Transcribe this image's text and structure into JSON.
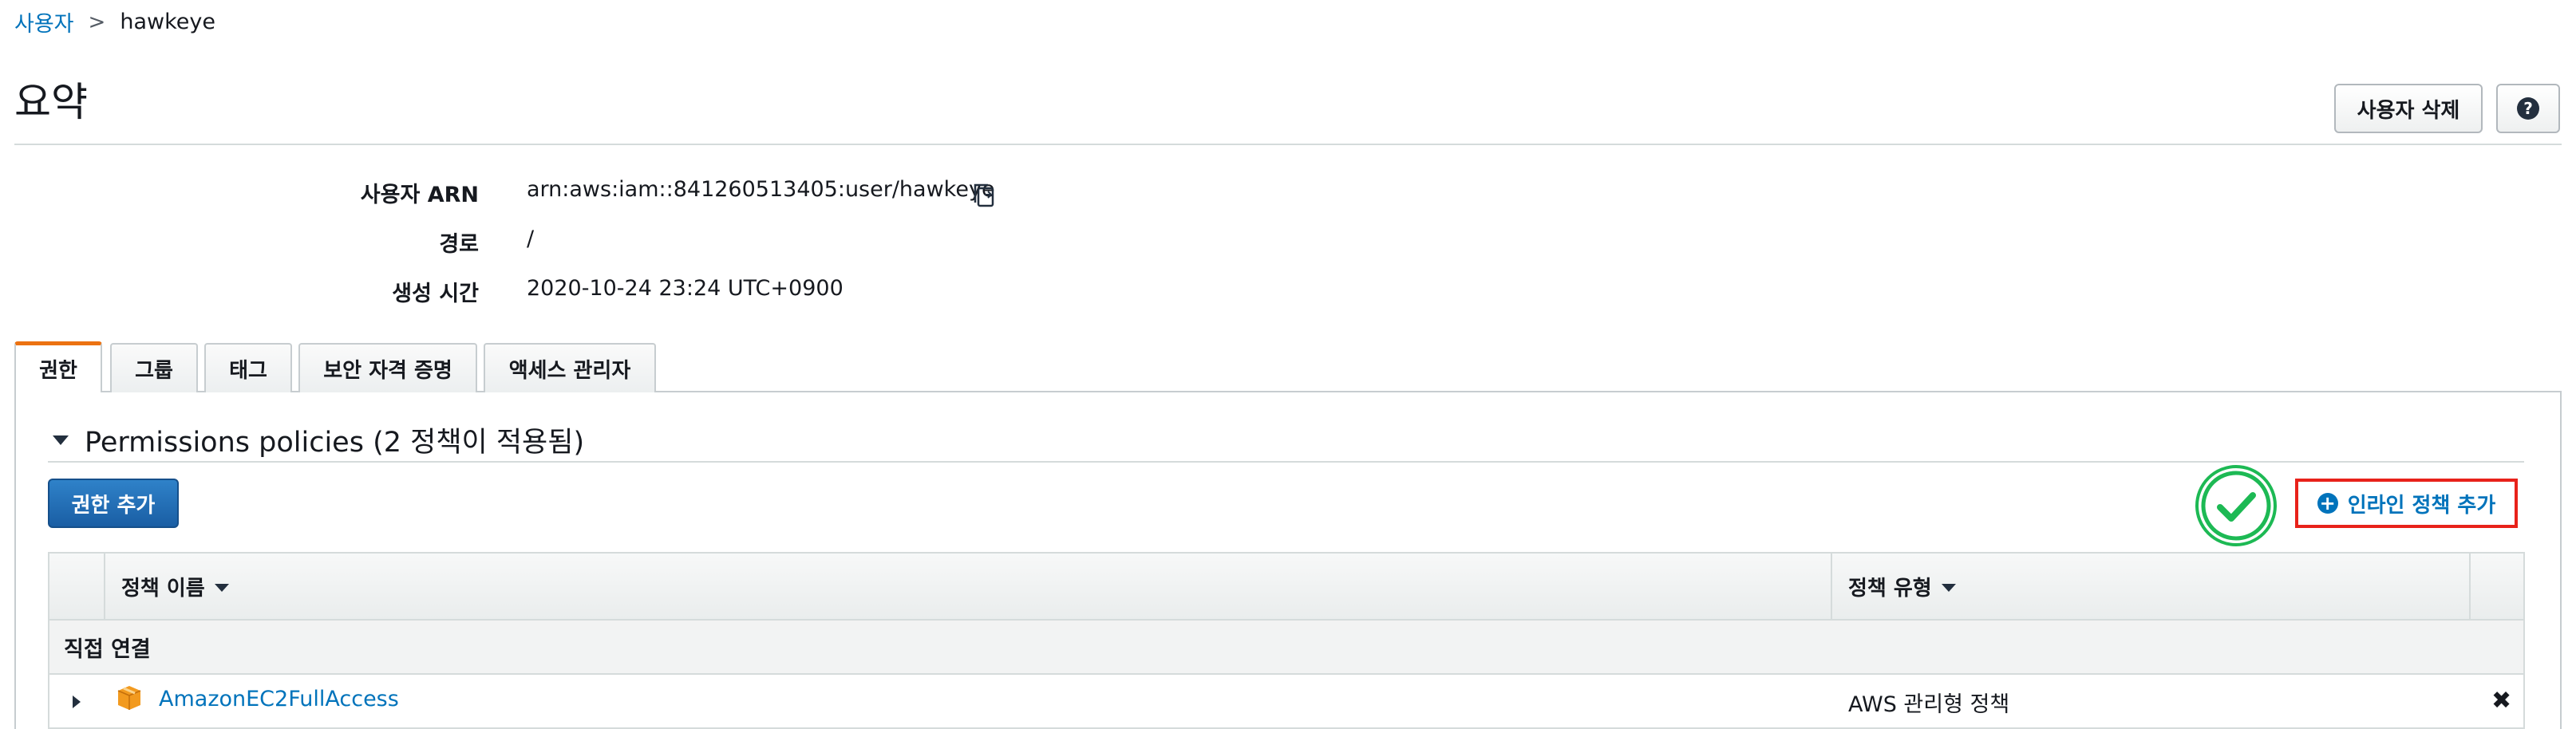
{
  "breadcrumb": {
    "parent": "사용자",
    "separator": ">",
    "current": "hawkeye"
  },
  "page": {
    "title": "요약"
  },
  "header_buttons": {
    "delete_user": "사용자 삭제",
    "help": "?"
  },
  "summary": {
    "arn_label": "사용자 ARN",
    "arn_value": "arn:aws:iam::841260513405:user/hawkeye",
    "path_label": "경로",
    "path_value": "/",
    "created_label": "생성 시간",
    "created_value": "2020-10-24 23:24 UTC+0900"
  },
  "tabs": [
    {
      "label": "권한",
      "active": true
    },
    {
      "label": "그룹",
      "active": false
    },
    {
      "label": "태그",
      "active": false
    },
    {
      "label": "보안 자격 증명",
      "active": false
    },
    {
      "label": "액세스 관리자",
      "active": false
    }
  ],
  "permissions": {
    "section_title": "Permissions policies (2 정책이 적용됨)",
    "add_permission_button": "권한 추가",
    "add_inline_policy": "인라인 정책 추가",
    "plus_symbol": "+",
    "table": {
      "col_policy_name": "정책 이름",
      "col_policy_type": "정책 유형",
      "group_label": "직접 연결",
      "rows": [
        {
          "name": "AmazonEC2FullAccess",
          "type": "AWS 관리형 정책",
          "remove": "✖"
        }
      ]
    }
  },
  "colors": {
    "link": "#0073bb",
    "primary_button": "#1a5ea4",
    "active_tab_accent": "#ec7211",
    "highlight_box": "#e8221a",
    "check_green": "#1db954"
  },
  "icons": [
    "copy-icon",
    "help-icon",
    "caret-down-icon",
    "checkmark-icon",
    "plus-circle-icon",
    "sort-caret-icon",
    "expand-caret-icon",
    "package-icon",
    "remove-icon"
  ]
}
